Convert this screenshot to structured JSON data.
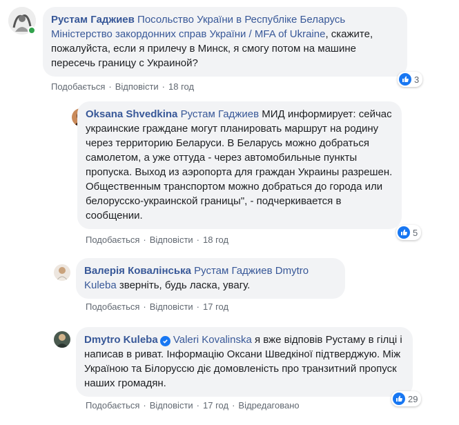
{
  "comments": [
    {
      "author": "Рустам Гаджиев",
      "mentions": [
        "Посольство України в Республіке Беларусь",
        "Міністерство закордонних справ України / MFA of Ukraine"
      ],
      "text_line1_after": "",
      "text": ", скажите, пожалуйста, если я прилечу в Минск, я смогу потом на машине пересечь границу с Украиной?",
      "like_label": "Подобається",
      "reply_label": "Відповісти",
      "time": "18 год",
      "reactions": "3"
    },
    {
      "author": "Oksana Shvedkina",
      "mention": "Рустам Гаджиев",
      "text": " МИД информирует: сейчас украинские граждане могут планировать маршрут на родину через территорию Беларуси. В Беларусь можно добраться самолетом, а уже оттуда - через автомобильные пункты пропуска. Выход из аэропорта для граждан Украины разрешен. Общественным транспортом можно добраться до города или белорусско-украинской границы\", - подчеркивается в сообщении.",
      "like_label": "Подобається",
      "reply_label": "Відповісти",
      "time": "18 год",
      "reactions": "5"
    },
    {
      "author": "Валерія Ковалінська",
      "mentions": [
        "Рустам Гаджиев",
        "Dmytro Kuleba"
      ],
      "text": "зверніть, будь ласка, увагу.",
      "like_label": "Подобається",
      "reply_label": "Відповісти",
      "time": "17 год"
    },
    {
      "author": "Dmytro Kuleba",
      "mention": "Valeri Kovalinska",
      "text": " я вже відповів Рустаму в гілці і написав в риват. Інформацію Оксани Шведкіної підтверджую. Між Україною та Білоруссю діє домовленість про транзитний пропуск наших громадян.",
      "like_label": "Подобається",
      "reply_label": "Відповісти",
      "time": "17 год",
      "edited_label": "Відредаговано",
      "reactions": "29"
    }
  ],
  "colors": {
    "link": "#385898",
    "bubble": "#f2f3f5",
    "meta": "#606770",
    "like": "#1877f2",
    "online": "#31a24c"
  }
}
